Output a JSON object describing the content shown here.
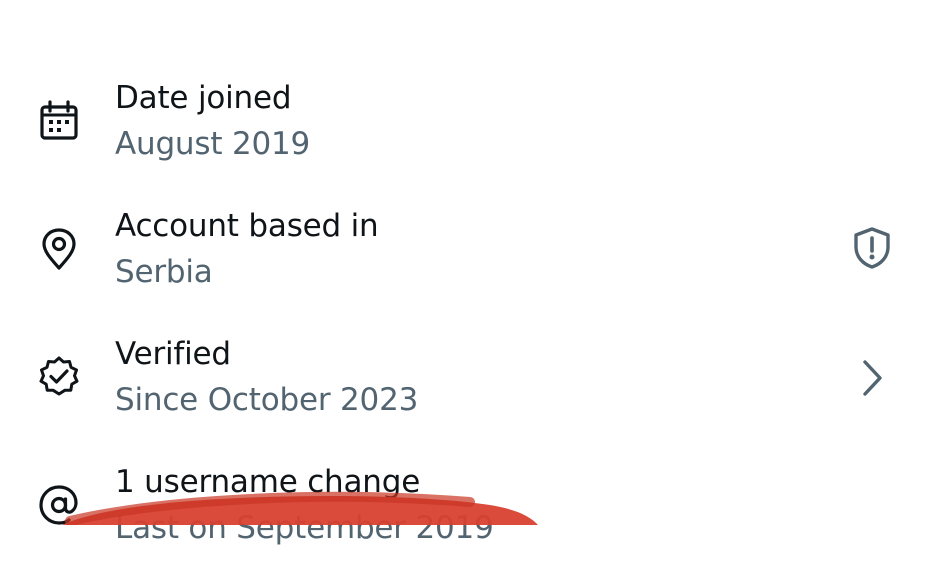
{
  "about_rows": [
    {
      "title": "Date joined",
      "subtitle": "August 2019",
      "icon": "calendar-icon",
      "action_icon": null
    },
    {
      "title": "Account based in",
      "subtitle": "Serbia",
      "icon": "location-pin-icon",
      "action_icon": "shield-alert-icon"
    },
    {
      "title": "Verified",
      "subtitle": "Since October 2023",
      "icon": "verified-badge-icon",
      "action_icon": "chevron-right-icon"
    },
    {
      "title": "1 username change",
      "subtitle": "Last on September 2019",
      "icon": "at-sign-icon",
      "action_icon": null
    }
  ],
  "colors": {
    "title_text": "#0f1419",
    "subtitle_text": "#536471",
    "icon": "#0f1419",
    "action_icon": "#536471",
    "annotation_scribble": "#d8402f"
  }
}
